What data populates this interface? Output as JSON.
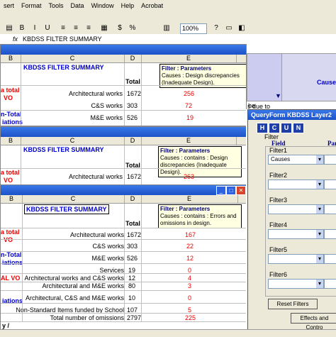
{
  "menu": [
    "sert",
    "Format",
    "Tools",
    "Data",
    "Window",
    "Help",
    "Acrobat"
  ],
  "toolbar": {
    "zoom": "100%"
  },
  "formula": {
    "fx": "fx",
    "value": "KBDSS FILTER SUMMARY"
  },
  "cols": {
    "b": "B",
    "c": "C",
    "d": "D",
    "e": "E"
  },
  "win1": {
    "title_cell": "KBDSS FILTER SUMMARY",
    "total": "Total",
    "tip": {
      "head": "Filter : Parameters",
      "body": "Causes : Design discrepancies (Inadequate Design)."
    },
    "left_a": "a total",
    "left_vo": "VO",
    "left_subtotal": "n-Total",
    "left_iations": "iations",
    "rows": [
      [
        "Architectural works",
        "1672",
        "256"
      ],
      [
        "C&S works",
        "303",
        "72"
      ],
      [
        "M&E works",
        "526",
        "19"
      ]
    ]
  },
  "win2": {
    "title_cell": "KBDSS FILTER SUMMARY",
    "total": "Total",
    "tip": {
      "head": "Filter : Parameters",
      "body": "Causes : contains : Design discrepancies (Inadequate Design)."
    },
    "left_a": "a total",
    "left_vo": "VO",
    "rows": [
      [
        "Architectural works",
        "1672",
        "263"
      ]
    ]
  },
  "win3": {
    "title_cell": "KBDSS FILTER SUMMARY",
    "total": "Total",
    "tip": {
      "head": "Filter : Parameters",
      "body": "Causes : contains : Errors and omissions in design."
    },
    "left_a": "a total",
    "left_vo": "VO",
    "left_subtotal": "n-Total",
    "left_iations": "iations",
    "left_alvo": "AL VO",
    "left_iations2": "iations",
    "rows": [
      [
        "Architectural works",
        "1672",
        "167"
      ],
      [
        "C&S works",
        "303",
        "22"
      ],
      [
        "M&E works",
        "526",
        "12"
      ],
      [
        "Services",
        "19",
        "0"
      ],
      [
        "Architectural works and C&S works",
        "12",
        "4"
      ],
      [
        "Architectural and M&E works",
        "80",
        "3"
      ],
      [
        "Architectural, C&S and M&E works",
        "10",
        "0"
      ],
      [
        "Non-Standard Items funded by School",
        "107",
        "5"
      ],
      [
        "Total number of omissions",
        "2797",
        "225"
      ]
    ],
    "sheet_tab": "y /"
  },
  "right_sheet": {
    "cause": "Causes",
    "texts": [
      "he",
      "s due to",
      "iss",
      "s",
      "in",
      "n",
      "n",
      "n",
      "s",
      "n",
      "ir",
      "P",
      "p",
      "e"
    ]
  },
  "queryform": {
    "title": "QueryForm KBDSS Layer2",
    "btns": [
      "H",
      "C",
      "U",
      "N"
    ],
    "filter_group": "Filter",
    "field_hdr": "Field",
    "param_hdr": "Para",
    "filters": [
      {
        "label": "Filter1",
        "value": "Causes"
      },
      {
        "label": "Filter2",
        "value": ""
      },
      {
        "label": "Filter3",
        "value": ""
      },
      {
        "label": "Filter4",
        "value": ""
      },
      {
        "label": "Filter5",
        "value": ""
      },
      {
        "label": "Filter6",
        "value": ""
      }
    ],
    "reset": "Reset Filters",
    "effects": "Effects and Contro"
  }
}
